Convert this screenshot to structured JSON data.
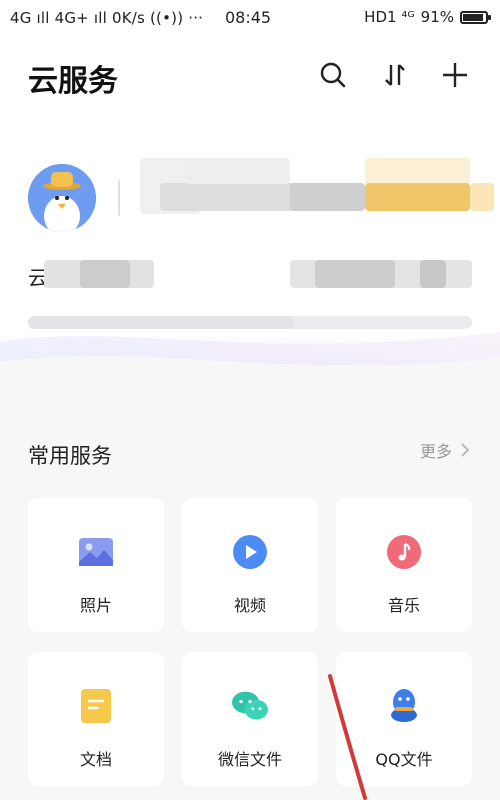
{
  "status": {
    "network_left": "4G ıll 4G+ ıll 0K/s ((•)) ···",
    "time": "08:45",
    "hd": "HD1 ⁴ᴳ",
    "battery": "91%",
    "battery_level": 0.91
  },
  "header": {
    "title": "云服务",
    "icons": [
      "search-icon",
      "transfer-icon",
      "add-icon"
    ]
  },
  "account": {
    "name_prefix": "云",
    "avatar": "avatar-duck-icon"
  },
  "common_services": {
    "title": "常用服务",
    "more_label": "更多",
    "items": [
      {
        "label": "照片",
        "icon": "photo-icon",
        "color": "#7b8ff0"
      },
      {
        "label": "视频",
        "icon": "video-icon",
        "color": "#4e8cf5"
      },
      {
        "label": "音乐",
        "icon": "music-icon",
        "color": "#f06a7a"
      },
      {
        "label": "文档",
        "icon": "document-icon",
        "color": "#f7c94a"
      },
      {
        "label": "微信文件",
        "icon": "wechat-icon",
        "color": "#30c4a8"
      },
      {
        "label": "QQ文件",
        "icon": "qq-icon",
        "color": "#3f7ee8"
      }
    ]
  }
}
